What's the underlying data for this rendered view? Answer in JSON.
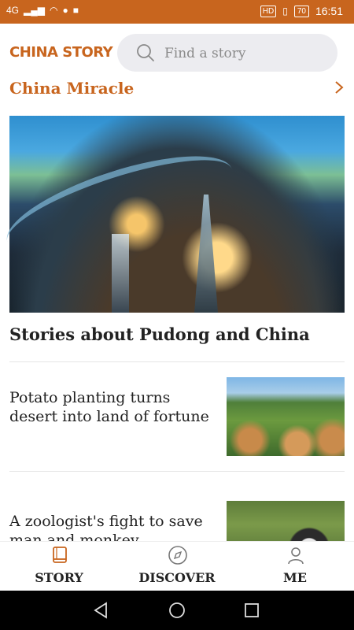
{
  "status_bar": {
    "network": "4G",
    "hd": "HD",
    "battery": "70",
    "time": "16:51"
  },
  "header": {
    "logo": "CHINA STORY",
    "search_placeholder": "Find a story"
  },
  "section": {
    "title": "China Miracle",
    "hero_caption": "Stories about Pudong and China"
  },
  "stories": [
    {
      "title": "Potato planting turns desert into land of fortune"
    },
    {
      "title": "A zoologist's fight to save man and monkey"
    }
  ],
  "tabs": [
    {
      "label": "STORY",
      "icon": "book-icon"
    },
    {
      "label": "DISCOVER",
      "icon": "compass-icon"
    },
    {
      "label": "ME",
      "icon": "person-icon"
    }
  ],
  "colors": {
    "brand": "#c8651e",
    "text": "#222222"
  }
}
